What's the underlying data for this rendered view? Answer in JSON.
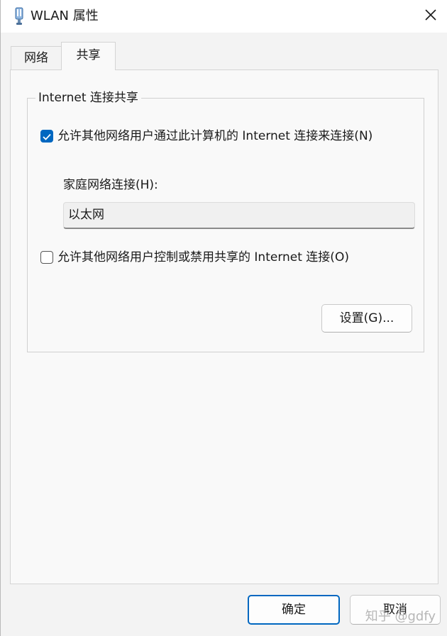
{
  "window": {
    "title": "WLAN 属性"
  },
  "tabs": [
    {
      "label": "网络",
      "selected": false
    },
    {
      "label": "共享",
      "selected": true
    }
  ],
  "sharing": {
    "group_title": "Internet 连接共享",
    "allow_sharing": {
      "label": "允许其他网络用户通过此计算机的 Internet 连接来连接(N)",
      "checked": true
    },
    "home_network_label": "家庭网络连接(H):",
    "home_network_value": "以太网",
    "allow_control": {
      "label": "允许其他网络用户控制或禁用共享的 Internet 连接(O)",
      "checked": false
    },
    "settings_button": "设置(G)..."
  },
  "footer": {
    "ok_label": "确定",
    "cancel_label": "取消"
  },
  "watermark": "知乎 @gdfy",
  "icons": {
    "title": "network-adapter-icon",
    "close": "close-icon",
    "check": "checkmark-icon"
  },
  "colors": {
    "accent": "#0067c0",
    "window_bg": "#f3f3f3",
    "panel_bg": "#f9f9f9"
  }
}
